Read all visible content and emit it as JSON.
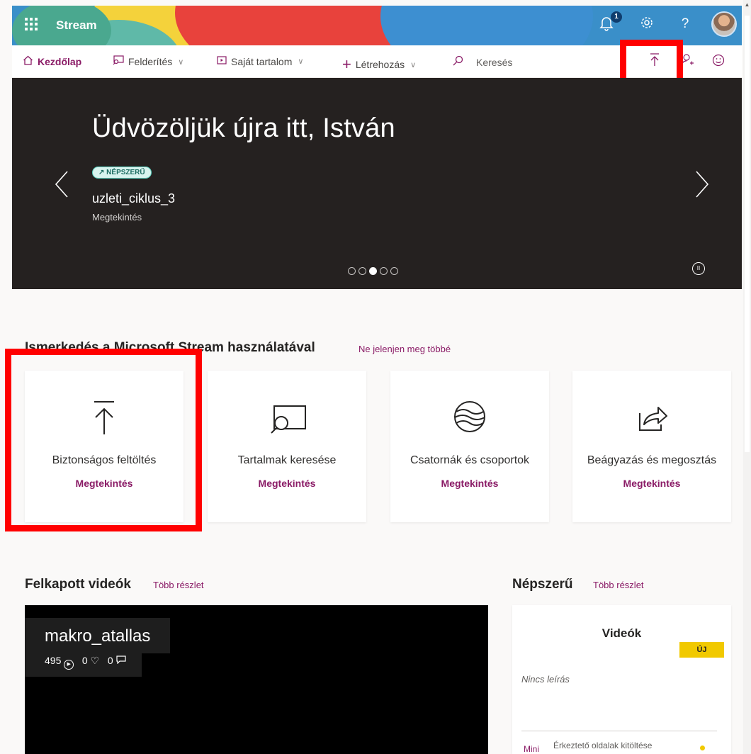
{
  "app": {
    "name": "Stream",
    "notification_count": "1"
  },
  "icons": {
    "waffle": "app-launcher-icon",
    "bell": "notification-bell-icon",
    "settings": "gear-icon",
    "help": "help-icon",
    "upload": "upload-icon",
    "invite": "add-person-icon",
    "feedback": "smiley-icon"
  },
  "nav": {
    "home": "Kezdőlap",
    "discover": "Felderítés",
    "my_content": "Saját tartalom",
    "create": "Létrehozás",
    "search_placeholder": "Keresés"
  },
  "hero": {
    "title": "Üdvözöljük újra itt, István",
    "badge": "NÉPSZERŰ",
    "video_title": "uzleti_ciklus_3",
    "video_meta": "Megtekintés",
    "active_slide": 3,
    "slide_count": 5
  },
  "getting_started": {
    "title": "Ismerkedés a Microsoft Stream használatával",
    "dismiss_link": "Ne jelenjen meg többé",
    "cards": [
      {
        "label": "Biztonságos feltöltés",
        "link": "Megtekintés",
        "icon": "upload-icon"
      },
      {
        "label": "Tartalmak keresése",
        "link": "Megtekintés",
        "icon": "search-screen-icon"
      },
      {
        "label": "Csatornák és csoportok",
        "link": "Megtekintés",
        "icon": "channels-icon"
      },
      {
        "label": "Beágyazás és megosztás",
        "link": "Megtekintés",
        "icon": "share-icon"
      }
    ]
  },
  "trending": {
    "title": "Felkapott videók",
    "more_link": "Több részlet",
    "video": {
      "title": "makro_atallas",
      "views": "495",
      "likes": "0",
      "comments": "0"
    }
  },
  "popular": {
    "title": "Népszerű",
    "more_link": "Több részlet",
    "card_title": "Videók",
    "badge": "ÚJ",
    "description": "Nincs leírás",
    "item_tag": "Mini",
    "item_title": "Érkeztető oldalak kitöltése"
  },
  "colors": {
    "accent": "#8a1b66",
    "topbar": "#3a8fc9",
    "hero_bg": "#252120",
    "highlight": "#ff0000",
    "new_badge": "#f1c900"
  }
}
